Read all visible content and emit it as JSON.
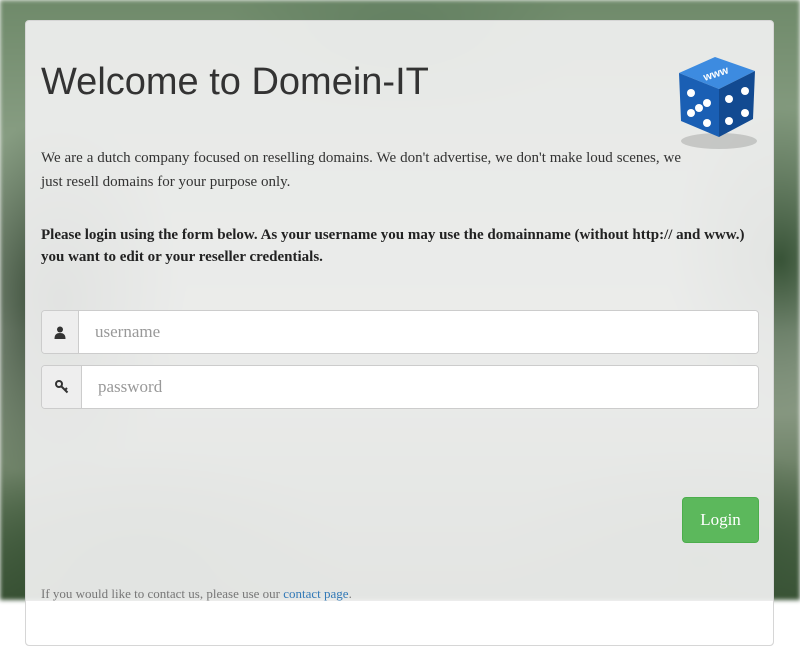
{
  "header": {
    "title": "Welcome to Domein-IT",
    "logo_text": "www"
  },
  "intro_text": "We are a dutch company focused on reselling domains. We don't advertise, we don't make loud scenes, we just resell domains for your purpose only.",
  "login_instructions": "Please login using the form below. As your username you may use the domainname (without http:// and www.) you want to edit or your reseller credentials.",
  "form": {
    "username": {
      "placeholder": "username",
      "value": "",
      "icon": "user-icon"
    },
    "password": {
      "placeholder": "password",
      "value": "",
      "icon": "key-icon"
    },
    "login_label": "Login"
  },
  "footer": {
    "contact_prefix": "If you would like to contact us, please use our ",
    "contact_link": "contact page",
    "contact_suffix": "."
  },
  "colors": {
    "primary_button": "#5cb85c",
    "link": "#337ab7",
    "logo_blue": "#1a5fb4"
  }
}
